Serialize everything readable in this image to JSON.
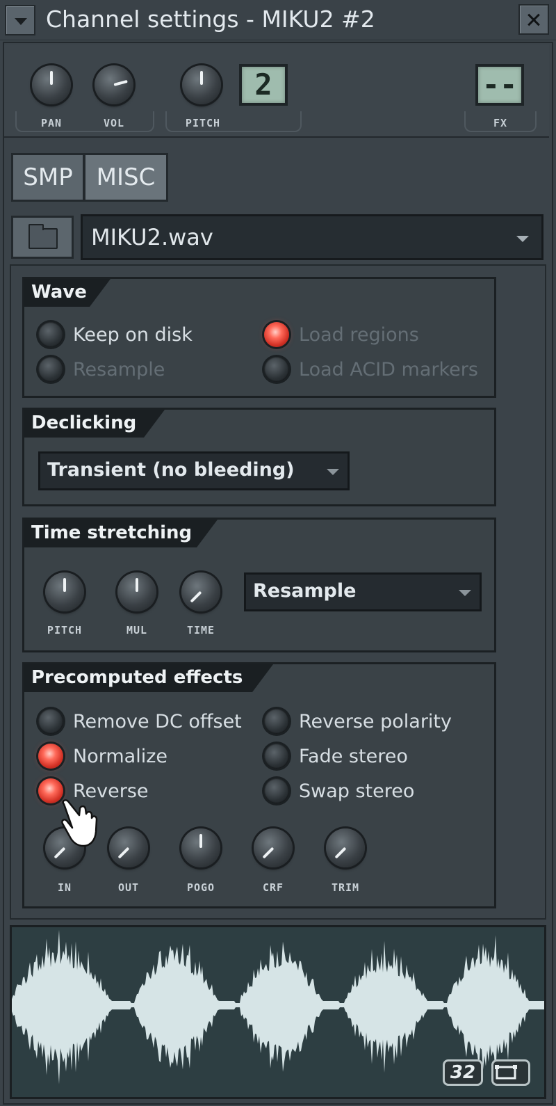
{
  "window": {
    "title": "Channel settings - MIKU2 #2"
  },
  "top_knobs": {
    "pan_label": "PAN",
    "vol_label": "VOL",
    "pitch_label": "PITCH",
    "fx_label": "FX",
    "pitch_lcd": "2",
    "fx_lcd": "--"
  },
  "tabs": {
    "smp": "SMP",
    "misc": "MISC"
  },
  "sample": {
    "file": "MIKU2.wav"
  },
  "wave": {
    "title": "Wave",
    "keep_on_disk": "Keep on disk",
    "resample": "Resample",
    "load_regions": "Load regions",
    "load_acid_markers": "Load ACID markers"
  },
  "declicking": {
    "title": "Declicking",
    "mode": "Transient (no bleeding)"
  },
  "time_stretching": {
    "title": "Time stretching",
    "knob_pitch": "PITCH",
    "knob_mul": "MUL",
    "knob_time": "TIME",
    "method": "Resample"
  },
  "precomputed": {
    "title": "Precomputed effects",
    "remove_dc": "Remove DC offset",
    "normalize": "Normalize",
    "reverse": "Reverse",
    "reverse_polarity": "Reverse polarity",
    "fade_stereo": "Fade stereo",
    "swap_stereo": "Swap stereo",
    "knob_in": "IN",
    "knob_out": "OUT",
    "knob_pogo": "POGO",
    "knob_crf": "CRF",
    "knob_trim": "TRIM"
  },
  "waveform": {
    "zoom_label": "32"
  },
  "states": {
    "load_regions": true,
    "normalize": true,
    "reverse": true
  },
  "colors": {
    "led_on": "#e0392c",
    "waveform": "#d6e4e6",
    "lcd": "#9fbcae"
  }
}
